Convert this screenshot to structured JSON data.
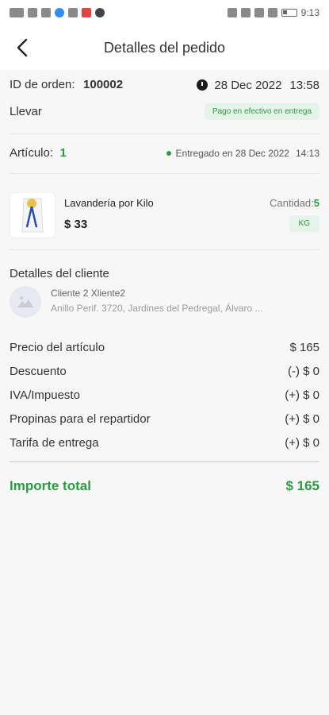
{
  "status_bar": {
    "left_label": "VoLTE",
    "right_label": "📶",
    "time": "9:13"
  },
  "header": {
    "title": "Detalles del pedido"
  },
  "order": {
    "id_label": "ID de orden:",
    "id_value": "100002",
    "date": "28 Dec 2022",
    "time": "13:58",
    "type": "Llevar",
    "payment_badge": "Pago en efectivo en entrega"
  },
  "item_summary": {
    "label": "Artículo:",
    "count": "1",
    "delivered_text": "Entregado en 28 Dec 2022",
    "delivered_time": "14:13"
  },
  "product": {
    "name": "Lavandería por Kilo",
    "price": "$ 33",
    "quantity_label": "Cantidad:",
    "quantity_value": "5",
    "unit_badge": "KG"
  },
  "customer": {
    "section_title": "Detalles del cliente",
    "name": "Cliente 2 Xliente2",
    "address": "Anillo Perif. 3720, Jardines del Pedregal, Álvaro ..."
  },
  "summary": {
    "rows": [
      {
        "label": "Precio del artículo",
        "value": "$ 165"
      },
      {
        "label": "Descuento",
        "value": "(-) $ 0"
      },
      {
        "label": "IVA/Impuesto",
        "value": "(+) $ 0"
      },
      {
        "label": "Propinas para el repartidor",
        "value": "(+) $ 0"
      },
      {
        "label": "Tarifa de entrega",
        "value": "(+) $ 0"
      }
    ],
    "total_label": "Importe total",
    "total_value": "$ 165"
  },
  "colors": {
    "accent_green": "#2c9a44",
    "chip_bg": "#e6f3e9",
    "background": "#f7f7f7"
  }
}
